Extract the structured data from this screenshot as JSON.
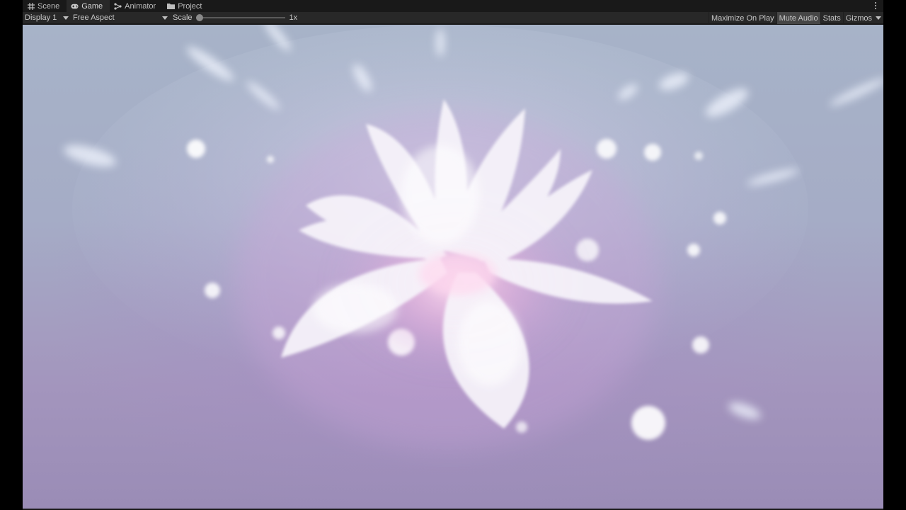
{
  "tabs": [
    {
      "label": "Scene",
      "icon": "grid-icon",
      "active": false
    },
    {
      "label": "Game",
      "icon": "gamepad-icon",
      "active": true
    },
    {
      "label": "Animator",
      "icon": "animator-icon",
      "active": false
    },
    {
      "label": "Project",
      "icon": "folder-icon",
      "active": false
    }
  ],
  "toolbar": {
    "display": "Display 1",
    "aspect": "Free Aspect",
    "scale_label": "Scale",
    "scale_value": "1x",
    "scale_slider_fraction": 0.0,
    "maximize_on_play": "Maximize On Play",
    "mute_audio": "Mute Audio",
    "stats": "Stats",
    "gizmos": "Gizmos"
  },
  "colors": {
    "editor_bg": "#191919",
    "toolbar_bg": "#282828",
    "toggle_on": "#464646"
  }
}
